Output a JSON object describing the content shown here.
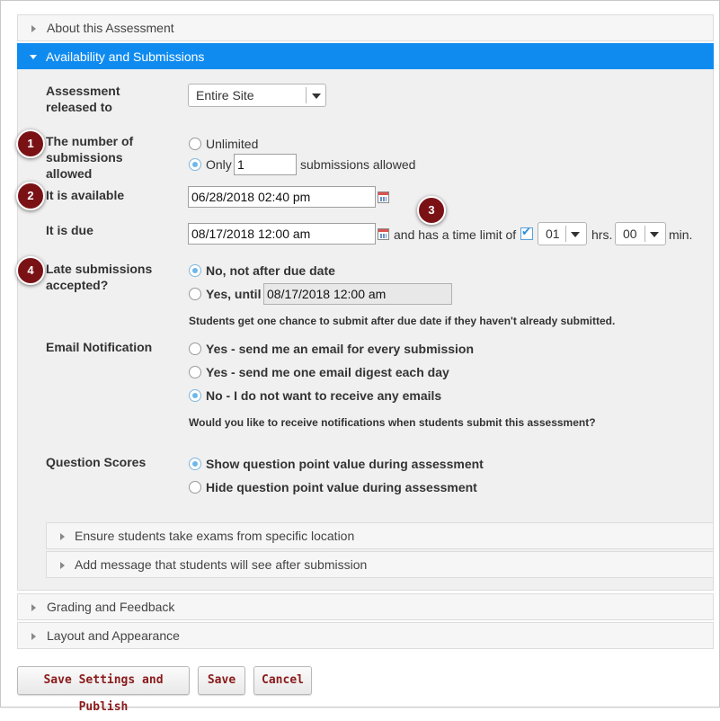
{
  "sections": {
    "about": "About this Assessment",
    "availability": "Availability and Submissions",
    "grading": "Grading and Feedback",
    "layout": "Layout and Appearance"
  },
  "released_to": {
    "label_line1": "Assessment",
    "label_line2": "released to",
    "value": "Entire Site"
  },
  "submissions": {
    "label_line1": "The number of",
    "label_line2": "submissions",
    "label_line3": "allowed",
    "unlimited": "Unlimited",
    "only": "Only",
    "count": "1",
    "suffix": "submissions allowed"
  },
  "available": {
    "label": "It is available",
    "value": "06/28/2018 02:40 pm"
  },
  "due": {
    "label": "It is due",
    "value": "08/17/2018 12:00 am",
    "time_limit_text": "and has a time limit of",
    "hours": "01",
    "hrs_label": "hrs.",
    "minutes": "00",
    "min_label": "min."
  },
  "late": {
    "label_line1": "Late submissions",
    "label_line2": "accepted?",
    "no": "No, not after due date",
    "yes": "Yes, until",
    "until_value": "08/17/2018 12:00 am",
    "help": "Students get one chance to submit after due date if they haven't already submitted."
  },
  "email": {
    "label": "Email Notification",
    "opt1": "Yes - send me an email for every submission",
    "opt2": "Yes - send me one email digest each day",
    "opt3": "No - I do not want to receive any emails",
    "help": "Would you like to receive notifications when students submit this assessment?"
  },
  "scores": {
    "label": "Question Scores",
    "show": "Show question point value during assessment",
    "hide": "Hide question point value during assessment"
  },
  "subsections": {
    "location": "Ensure students take exams from specific location",
    "message": "Add message that students will see after submission"
  },
  "badges": [
    "1",
    "2",
    "3",
    "4"
  ],
  "buttons": {
    "publish": "Save Settings and Publish",
    "save": "Save",
    "cancel": "Cancel"
  },
  "colors": {
    "accent": "#0f8bf0",
    "badge": "#7a1215",
    "button_text": "#8b1a1a"
  }
}
